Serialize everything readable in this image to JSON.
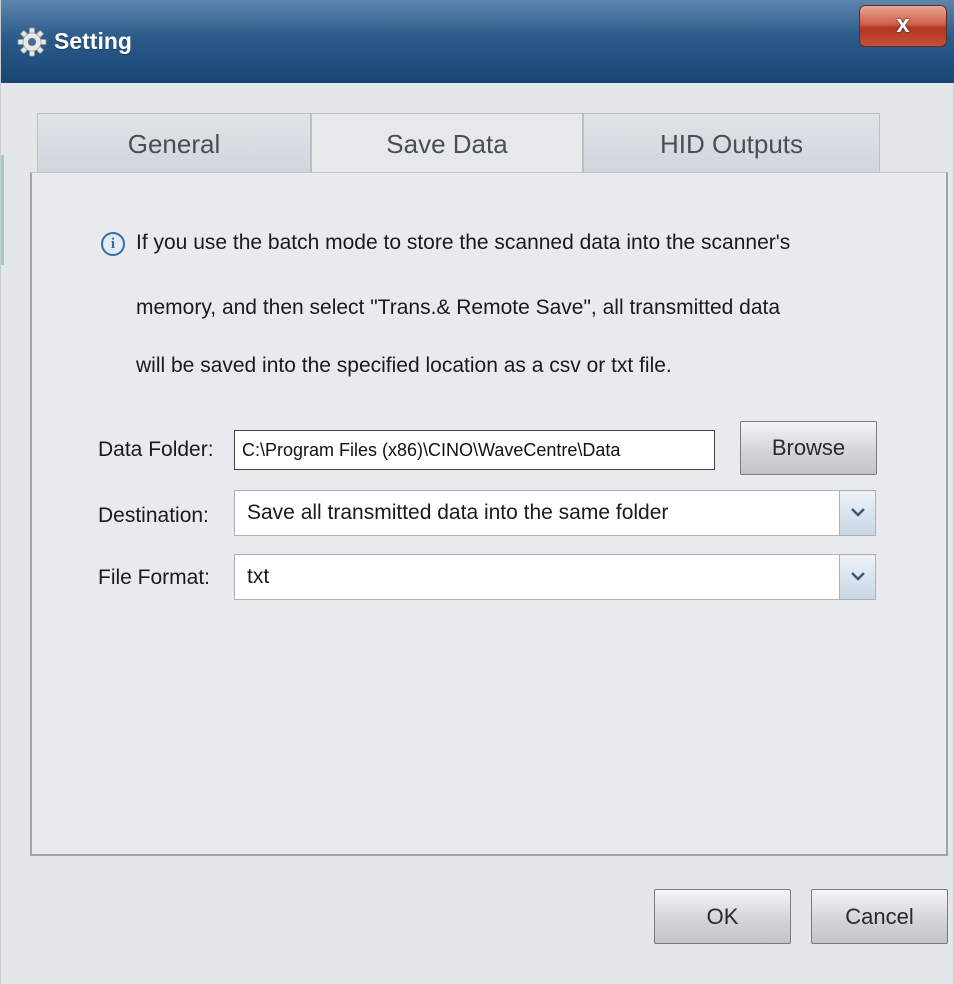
{
  "window": {
    "title": "Setting",
    "title_icon": "gear-icon",
    "close_label": "x"
  },
  "tabs": [
    {
      "label": "General",
      "active": false
    },
    {
      "label": "Save Data",
      "active": true
    },
    {
      "label": "HID Outputs",
      "active": false
    }
  ],
  "info": {
    "icon": "info-icon",
    "lines": [
      "If you use the batch mode to store the scanned data into the scanner's",
      "memory, and then select \"Trans.& Remote Save\", all transmitted data",
      "will be saved into the specified location as a csv or txt file."
    ]
  },
  "form": {
    "data_folder_label": "Data Folder:",
    "data_folder_value": "C:\\Program Files (x86)\\CINO\\WaveCentre\\Data",
    "browse_label": "Browse",
    "destination_label": "Destination:",
    "destination_value": "Save all transmitted data into the same folder",
    "file_format_label": "File Format:",
    "file_format_value": "txt"
  },
  "footer": {
    "ok_label": "OK",
    "cancel_label": "Cancel"
  },
  "colors": {
    "titlebar": "#2b5b8a",
    "close_button": "#c44f36",
    "info_icon": "#2d6fb0"
  }
}
